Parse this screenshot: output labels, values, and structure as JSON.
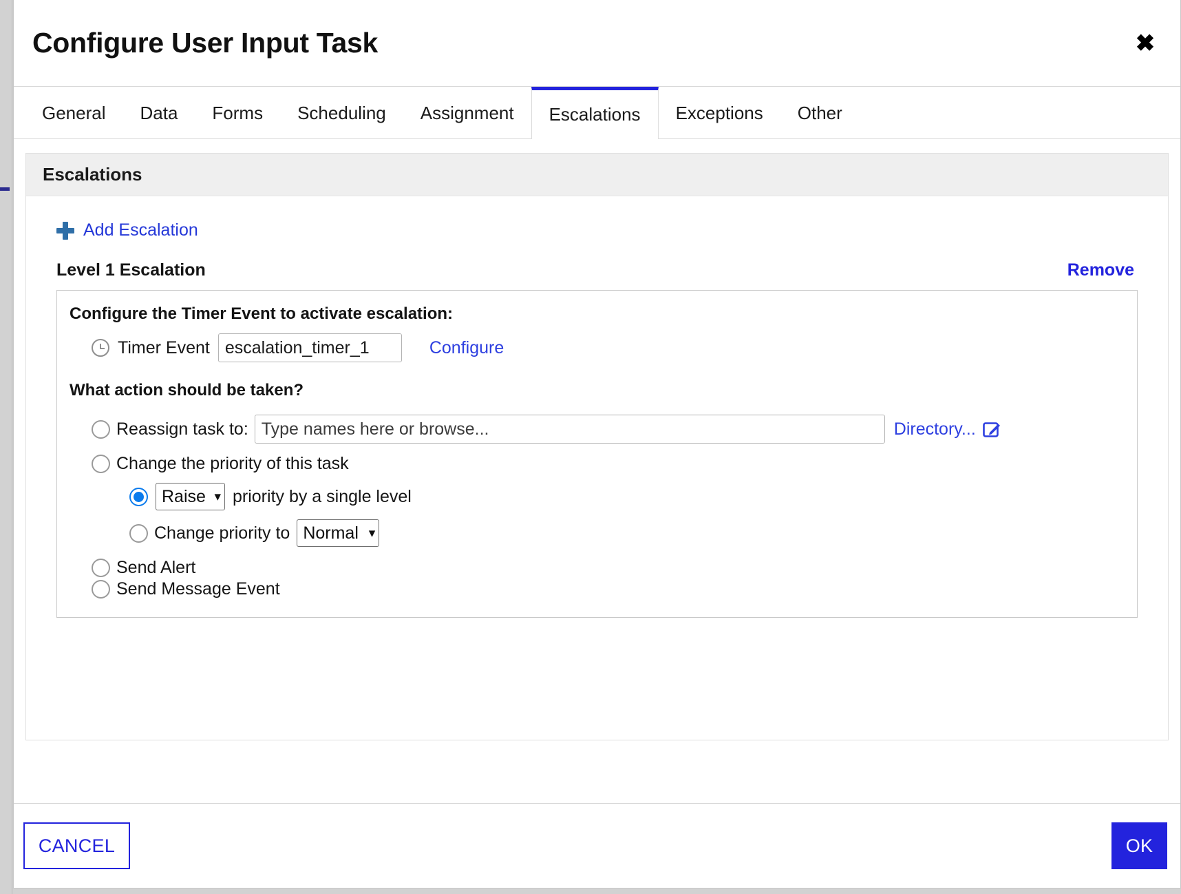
{
  "dialog": {
    "title": "Configure User Input Task",
    "close_icon": "close-icon",
    "close_glyph": "✖"
  },
  "tabs": [
    {
      "label": "General",
      "active": false
    },
    {
      "label": "Data",
      "active": false
    },
    {
      "label": "Forms",
      "active": false
    },
    {
      "label": "Scheduling",
      "active": false
    },
    {
      "label": "Assignment",
      "active": false
    },
    {
      "label": "Escalations",
      "active": true
    },
    {
      "label": "Exceptions",
      "active": false
    },
    {
      "label": "Other",
      "active": false
    }
  ],
  "panel": {
    "header_title": "Escalations",
    "add_escalation": {
      "icon": "plus-icon",
      "label": "Add Escalation"
    },
    "escalation": {
      "level_title": "Level 1 Escalation",
      "remove_label": "Remove",
      "timer_section_label": "Configure the Timer Event to activate escalation:",
      "timer": {
        "icon": "clock-icon",
        "label": "Timer Event",
        "value": "escalation_timer_1",
        "placeholder": "",
        "configure_label": "Configure"
      },
      "action_section_label": "What action should be taken?",
      "options": {
        "reassign": {
          "label": "Reassign task to:",
          "selected": false,
          "input_value": "",
          "input_placeholder": "Type names here or browse...",
          "directory_label": "Directory...",
          "directory_icon": "edit-square-icon"
        },
        "change_priority": {
          "label": "Change the priority of this task",
          "selected": false,
          "raise_option": {
            "selected": true,
            "select_value": "Raise",
            "select_options": [
              "Raise",
              "Lower"
            ],
            "suffix_label": "priority by a single level"
          },
          "change_to_option": {
            "selected": false,
            "label": "Change priority to",
            "select_value": "Normal",
            "select_options": [
              "Highest",
              "High",
              "Normal",
              "Low",
              "Lowest"
            ]
          }
        },
        "send_alert": {
          "label": "Send Alert",
          "selected": false
        },
        "send_message_event": {
          "label": "Send Message Event",
          "selected": false
        }
      }
    }
  },
  "footer": {
    "cancel_label": "CANCEL",
    "ok_label": "OK"
  },
  "colors": {
    "accent_blue": "#2323dd",
    "link_blue": "#2d3fe0",
    "radio_blue": "#0a7bed",
    "plus_blue": "#2f6fa8",
    "panel_header_gray": "#efefef"
  }
}
